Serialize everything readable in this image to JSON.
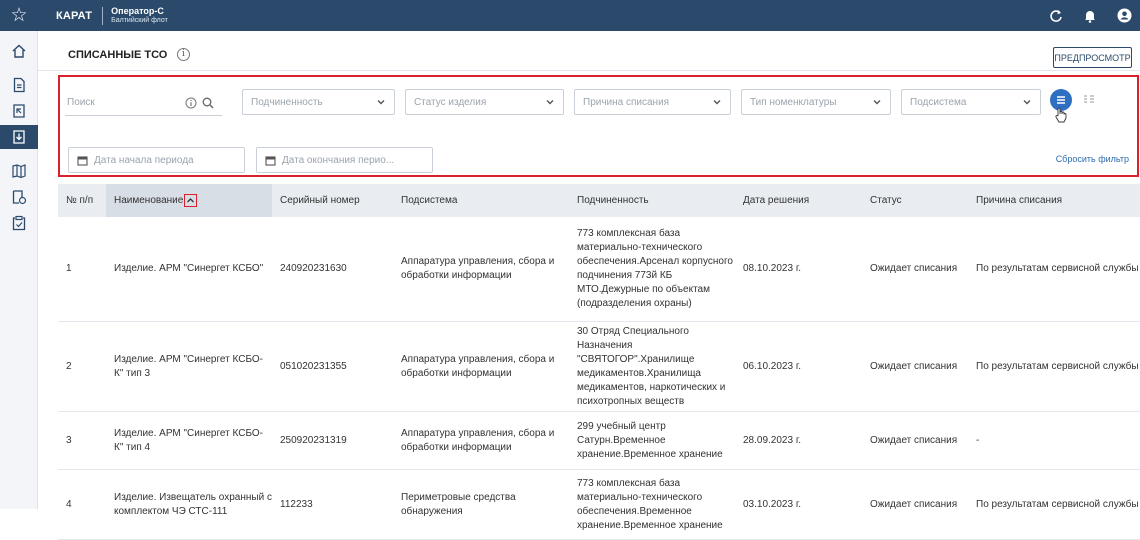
{
  "app": {
    "brand": "КАРАТ",
    "user_name": "Оператор-С",
    "user_sub": "Балтийский флот"
  },
  "header": {
    "title": "СПИСАННЫЕ ТСО",
    "preview_label": "ПРЕДПРОСМОТР"
  },
  "filters": {
    "search_placeholder": "Поиск",
    "subordination": "Подчиненность",
    "item_status": "Статус изделия",
    "writeoff_reason": "Причина списания",
    "nomenclature_type": "Тип номенклатуры",
    "subsystem": "Подсистема",
    "date_start": "Дата начала периода",
    "date_end": "Дата окончания перио...",
    "reset_label": "Сбросить фильтр"
  },
  "table": {
    "columns": [
      "№ п/п",
      "Наименование",
      "Серийный номер",
      "Подсистема",
      "Подчиненность",
      "Дата решения",
      "Статус",
      "Причина списания"
    ],
    "rows": [
      {
        "num": "1",
        "name": "Изделие. АРМ \"Синергет КСБО\"",
        "serial": "240920231630",
        "subsystem": "Аппаратура управления, сбора и обработки информации",
        "subordination": "773 комплексная база материально-технического обеспечения.Арсенал корпусного подчинения 773й КБ МТО.Дежурные по объектам (подразделения охраны)",
        "date": "08.10.2023 г.",
        "status": "Ожидает списания",
        "reason": "По результатам сервисной службы"
      },
      {
        "num": "2",
        "name": "Изделие. АРМ \"Синергет КСБО-К\" тип 3",
        "serial": "051020231355",
        "subsystem": "Аппаратура управления, сбора и обработки информации",
        "subordination": "30 Отряд Специального Назначения \"СВЯТОГОР\".Хранилище медикаментов.Хранилища медикаментов, наркотических и психотропных веществ",
        "date": "06.10.2023 г.",
        "status": "Ожидает списания",
        "reason": "По результатам сервисной службы"
      },
      {
        "num": "3",
        "name": "Изделие. АРМ \"Синергет КСБО-К\" тип 4",
        "serial": "250920231319",
        "subsystem": "Аппаратура управления, сбора и обработки информации",
        "subordination": "299 учебный центр Сатурн.Временное хранение.Временное хранение",
        "date": "28.09.2023 г.",
        "status": "Ожидает списания",
        "reason": "-"
      },
      {
        "num": "4",
        "name": "Изделие. Извещатель охранный с комплектом ЧЭ СТС-111",
        "serial": "112233",
        "subsystem": "Периметровые средства обнаружения",
        "subordination": "773 комплексная база материально-технического обеспечения.Временное хранение.Временное хранение",
        "date": "03.10.2023 г.",
        "status": "Ожидает списания",
        "reason": "По результатам сервисной службы"
      }
    ]
  }
}
